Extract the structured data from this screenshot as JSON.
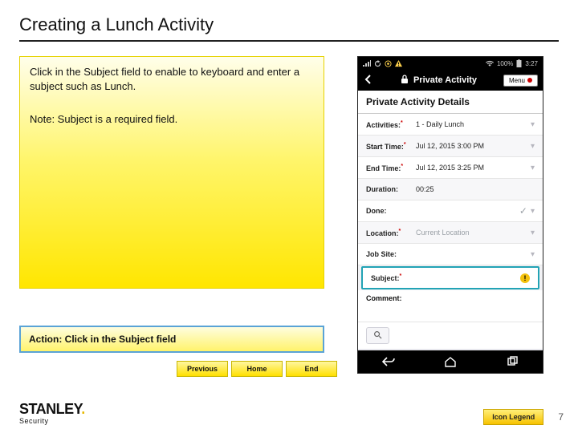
{
  "title": "Creating a Lunch Activity",
  "note": {
    "p1": "Click in the Subject field to enable to keyboard and enter a subject such as Lunch.",
    "p2": "Note: Subject is a required field."
  },
  "action_bar": "Action:  Click in the Subject field",
  "nav": {
    "previous": "Previous",
    "home": "Home",
    "end": "End"
  },
  "footer": {
    "logo_main": "STANLEY",
    "logo_sub": "Security",
    "legend": "Icon Legend",
    "page": "7"
  },
  "phone": {
    "statusbar": {
      "signal_icon": "signal-icon",
      "refresh_icon": "refresh-icon",
      "target_icon": "target-icon",
      "warning_icon": "warning-icon",
      "wifi_icon": "wifi-icon",
      "battery": "100%",
      "time": "3:27"
    },
    "appbar": {
      "title": "Private Activity",
      "menu": "Menu"
    },
    "section": "Private Activity Details",
    "rows": {
      "activities": {
        "label": "Activities:",
        "value": "1 - Daily Lunch"
      },
      "start": {
        "label": "Start Time:",
        "value": "Jul 12, 2015 3:00 PM"
      },
      "end": {
        "label": "End Time:",
        "value": "Jul 12, 2015 3:25 PM"
      },
      "duration": {
        "label": "Duration:",
        "value": "00:25"
      },
      "done": {
        "label": "Done:"
      },
      "location": {
        "label": "Location:",
        "placeholder": "Current Location"
      },
      "jobsite": {
        "label": "Job Site:"
      },
      "subject": {
        "label": "Subject:"
      },
      "comment": {
        "label": "Comment:"
      }
    }
  }
}
